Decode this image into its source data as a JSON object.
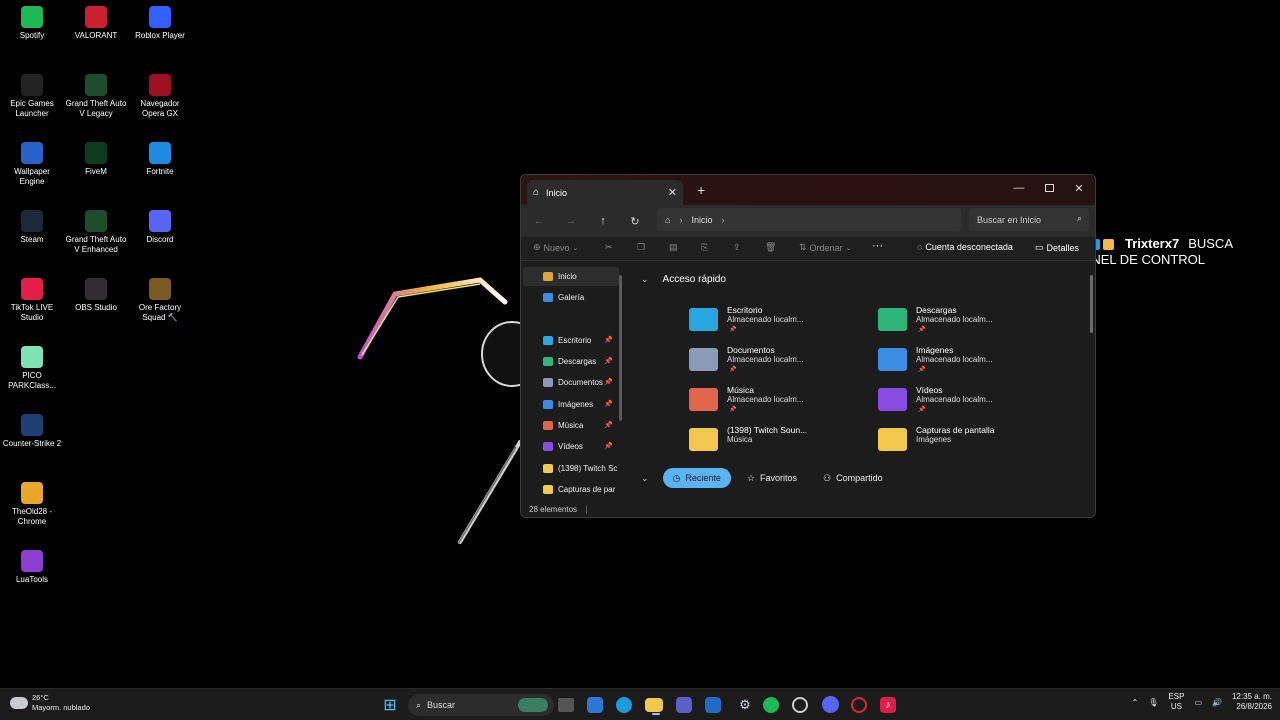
{
  "desktop": {
    "icons": [
      {
        "label": "Spotify",
        "icon": "spotify-icon",
        "color": "#1db954"
      },
      {
        "label": "VALORANT",
        "icon": "valorant-icon",
        "color": "#c8202d"
      },
      {
        "label": "Roblox Player",
        "icon": "roblox-icon",
        "color": "#335fff"
      },
      {
        "label": "Epic Games Launcher",
        "icon": "epic-games-icon",
        "color": "#222222"
      },
      {
        "label": "Grand Theft Auto V Legacy",
        "icon": "gta-v-icon",
        "color": "#1e4d2b"
      },
      {
        "label": "Navegador Opera GX",
        "icon": "opera-gx-icon",
        "color": "#9c1020"
      },
      {
        "label": "Wallpaper Engine",
        "icon": "wallpaper-engine-icon",
        "color": "#2961c8"
      },
      {
        "label": "FiveM",
        "icon": "fivem-icon",
        "color": "#0d3b1e"
      },
      {
        "label": "Fortnite",
        "icon": "fortnite-icon",
        "color": "#1c8be0"
      },
      {
        "label": "Steam",
        "icon": "steam-icon",
        "color": "#1b2838"
      },
      {
        "label": "Grand Theft Auto V Enhanced",
        "icon": "gta-v-icon",
        "color": "#1e4d2b"
      },
      {
        "label": "Discord",
        "icon": "discord-icon",
        "color": "#5865f2"
      },
      {
        "label": "TikTok LIVE Studio",
        "icon": "tiktok-live-icon",
        "color": "#e11d48"
      },
      {
        "label": "OBS Studio",
        "icon": "obs-icon",
        "color": "#302e31"
      },
      {
        "label": "Ore Factory Squad 🔨",
        "icon": "ore-factory-icon",
        "color": "#7a5a20"
      },
      {
        "label": "PICO PARKClass...",
        "icon": "pico-park-icon",
        "color": "#7de3b4"
      },
      {
        "label": "Counter-Strike 2",
        "icon": "counter-strike-icon",
        "color": "#1d3f74"
      },
      {
        "label": "TheOld28 - Chrome",
        "icon": "chrome-icon",
        "color": "#e8a72a"
      },
      {
        "label": "LuaTools",
        "icon": "luatools-icon",
        "color": "#8a3fd0"
      }
    ]
  },
  "overlay": {
    "name": "Trixterx7",
    "line1": "BUSCA",
    "line2": "PANEL DE CONTROL"
  },
  "explorer": {
    "tab_title": "Inicio",
    "address_path": "Inicio",
    "search_placeholder": "Buscar en Inicio",
    "commands": {
      "new": "Nuevo",
      "sort": "Ordenar",
      "more": "···",
      "account": "Cuenta desconectada",
      "details": "Detalles"
    },
    "sidebar": [
      {
        "label": "Inicio",
        "icon": "home-icon",
        "color": "#e3a53a",
        "pinned": false
      },
      {
        "label": "Galería",
        "icon": "gallery-icon",
        "color": "#3a8de3",
        "pinned": false
      },
      {
        "label": "Escritorio",
        "icon": "desktop-folder-icon",
        "color": "#2ba7e0",
        "pinned": true
      },
      {
        "label": "Descargas",
        "icon": "downloads-icon",
        "color": "#2fb67a",
        "pinned": true
      },
      {
        "label": "Documentos",
        "icon": "documents-icon",
        "color": "#8a9bb5",
        "pinned": true
      },
      {
        "label": "Imágenes",
        "icon": "pictures-icon",
        "color": "#3a8de3",
        "pinned": true
      },
      {
        "label": "Música",
        "icon": "music-icon",
        "color": "#e0654a",
        "pinned": true
      },
      {
        "label": "Vídeos",
        "icon": "videos-icon",
        "color": "#8a4be0",
        "pinned": true
      },
      {
        "label": "(1398) Twitch Sc",
        "icon": "folder-icon",
        "color": "#f2c94c",
        "pinned": false
      },
      {
        "label": "Capturas de par",
        "icon": "folder-icon",
        "color": "#f2c94c",
        "pinned": false
      }
    ],
    "quick_access": {
      "title": "Acceso rápido",
      "items": [
        {
          "name": "Escritorio",
          "sub": "Almacenado localm...",
          "icon": "desktop-folder-icon",
          "color": "#27a6df",
          "pinned": true
        },
        {
          "name": "Descargas",
          "sub": "Almacenado localm...",
          "icon": "downloads-folder-icon",
          "color": "#2db57a",
          "pinned": true
        },
        {
          "name": "Documentos",
          "sub": "Almacenado localm...",
          "icon": "documents-folder-icon",
          "color": "#8a9bb5",
          "pinned": true
        },
        {
          "name": "Imágenes",
          "sub": "Almacenado localm...",
          "icon": "pictures-folder-icon",
          "color": "#3a8de3",
          "pinned": true
        },
        {
          "name": "Música",
          "sub": "Almacenado localm...",
          "icon": "music-folder-icon",
          "color": "#e0654a",
          "pinned": true
        },
        {
          "name": "Vídeos",
          "sub": "Almacenado localm...",
          "icon": "videos-folder-icon",
          "color": "#8a4be0",
          "pinned": true
        },
        {
          "name": "(1398) Twitch Soun...",
          "sub": "Música",
          "icon": "folder-icon",
          "color": "#f2c94c",
          "pinned": false
        },
        {
          "name": "Capturas de pantalla",
          "sub": "Imágenes",
          "icon": "folder-icon",
          "color": "#f2c94c",
          "pinned": false
        }
      ]
    },
    "filters": {
      "recent": "Reciente",
      "favorites": "Favoritos",
      "shared": "Compartido"
    },
    "status": "28 elementos"
  },
  "taskbar": {
    "temp": "26°C",
    "condition": "Mayorm. nublado",
    "search_placeholder": "Buscar",
    "lang_line1": "ESP",
    "lang_line2": "US",
    "time": "12:35 a. m.",
    "date": "26/8/2026"
  }
}
